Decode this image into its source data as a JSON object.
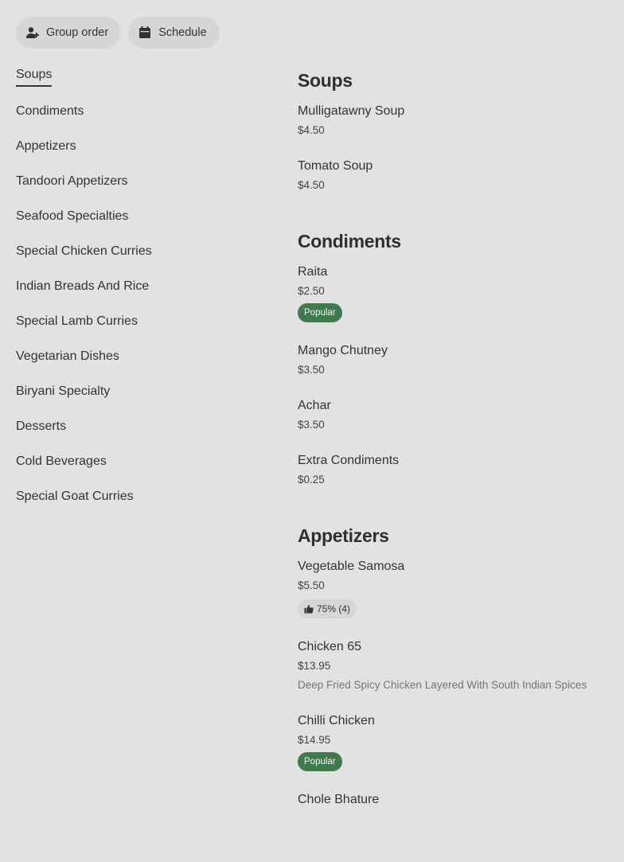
{
  "actions": {
    "group_order": "Group order",
    "schedule": "Schedule"
  },
  "sidebar": {
    "items": [
      {
        "label": "Soups"
      },
      {
        "label": "Condiments"
      },
      {
        "label": "Appetizers"
      },
      {
        "label": "Tandoori Appetizers"
      },
      {
        "label": "Seafood Specialties"
      },
      {
        "label": "Special Chicken Curries"
      },
      {
        "label": "Indian Breads And Rice"
      },
      {
        "label": "Special Lamb Curries"
      },
      {
        "label": "Vegetarian Dishes"
      },
      {
        "label": "Biryani Specialty"
      },
      {
        "label": "Desserts"
      },
      {
        "label": "Cold Beverages"
      },
      {
        "label": "Special Goat Curries"
      }
    ],
    "active": "Soups"
  },
  "sections": [
    {
      "title": "Soups",
      "items": [
        {
          "name": "Mulligatawny Soup",
          "price": "$4.50"
        },
        {
          "name": "Tomato Soup",
          "price": "$4.50"
        }
      ]
    },
    {
      "title": "Condiments",
      "items": [
        {
          "name": "Raita",
          "price": "$2.50",
          "badge": "Popular"
        },
        {
          "name": "Mango Chutney",
          "price": "$3.50"
        },
        {
          "name": "Achar",
          "price": "$3.50"
        },
        {
          "name": "Extra Condiments",
          "price": "$0.25"
        }
      ]
    },
    {
      "title": "Appetizers",
      "items": [
        {
          "name": "Vegetable Samosa",
          "price": "$5.50",
          "rating": "75% (4)"
        },
        {
          "name": "Chicken 65",
          "price": "$13.95",
          "description": "Deep Fried Spicy Chicken Layered With South Indian Spices"
        },
        {
          "name": "Chilli Chicken",
          "price": "$14.95",
          "badge": "Popular"
        },
        {
          "name": "Chole Bhature",
          "price": ""
        }
      ]
    }
  ],
  "colors": {
    "background": "#e2e2e2",
    "popular_badge": "#3f7a4f",
    "pill": "#d6d6d6"
  }
}
